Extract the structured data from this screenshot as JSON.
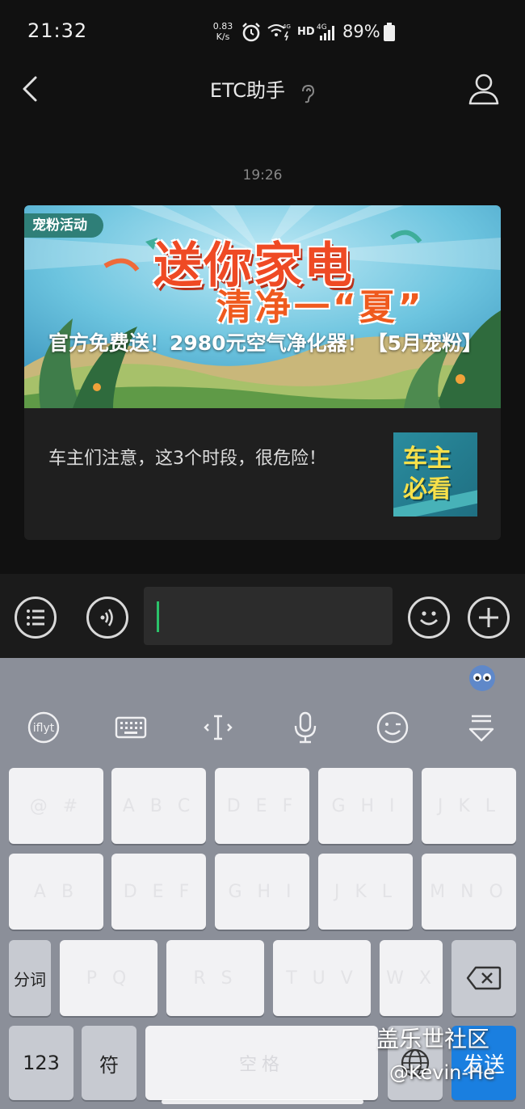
{
  "status_bar": {
    "time": "21:32",
    "net_speed_value": "0.83",
    "net_speed_unit": "K/s",
    "hd": "HD",
    "battery_percent": "89%",
    "icons": [
      "alarm-icon",
      "wifi-icon",
      "signal-4g-icon",
      "battery-icon"
    ]
  },
  "nav": {
    "title": "ETC助手",
    "icons": [
      "back-icon",
      "ear-icon",
      "profile-icon"
    ]
  },
  "chat": {
    "timestamp": "19:26",
    "article": {
      "tag": "宠粉活动",
      "banner_headline": "送你家电",
      "banner_subtitle": "清净一“夏”",
      "title": "官方免费送！2980元空气净化器！【5月宠粉】",
      "sub_title": "车主们注意，这3个时段，很危险！",
      "sub_thumb_text": "车主必看"
    }
  },
  "input_bar": {
    "value": "",
    "icons": [
      "menu-list-icon",
      "voice-icon",
      "emoji-icon",
      "plus-icon"
    ]
  },
  "keyboard": {
    "toolbar_icons": [
      "xunfei-icon",
      "keyboard-icon",
      "cursor-icon",
      "microphone-icon",
      "wink-emoji-icon",
      "collapse-keyboard-icon"
    ],
    "row1_hints": [
      "@ #",
      "A B C",
      "D E F",
      "G H I",
      "J K L"
    ],
    "row2_hints": [
      "A B",
      "D E F",
      "G H I",
      "J K L",
      "M N O"
    ],
    "row3_label": "分词",
    "row3_hints": [
      "P Q",
      "R S",
      "T U V",
      "W X"
    ],
    "bottom_labels": {
      "numbers": "123",
      "symbols": "符",
      "space_hint": "空格",
      "send": "发送"
    },
    "accent_color": "#1a7fe0"
  },
  "watermark": {
    "line1": "盖乐世社区",
    "line2": "@Kevin-He"
  }
}
